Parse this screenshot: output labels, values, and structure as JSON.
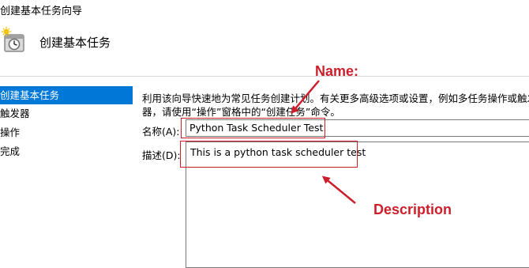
{
  "window": {
    "title": "创建基本任务向导"
  },
  "header": {
    "icon": "clock-task-icon",
    "title": "创建基本任务"
  },
  "nav": {
    "items": [
      {
        "label": "创建基本任务",
        "selected": true
      },
      {
        "label": "触发器",
        "selected": false
      },
      {
        "label": "操作",
        "selected": false
      },
      {
        "label": "完成",
        "selected": false
      }
    ]
  },
  "main": {
    "description_line1": "利用该向导快速地为常见任务创建计划。有关更多高级选项或设置，例如多任务操作或触发",
    "description_line2": "器，请使用“操作”窗格中的“创建任务”命令。",
    "name_label": "名称(A):",
    "name_value": "Python Task Scheduler Test",
    "desc_label": "描述(D):",
    "desc_value": "This is a python task scheduler test"
  },
  "annotations": {
    "name_label": "Name:",
    "desc_label": "Description",
    "color": "#cc1f2b"
  },
  "colors": {
    "selected_bg": "#0078d7",
    "selected_fg": "#ffffff"
  }
}
